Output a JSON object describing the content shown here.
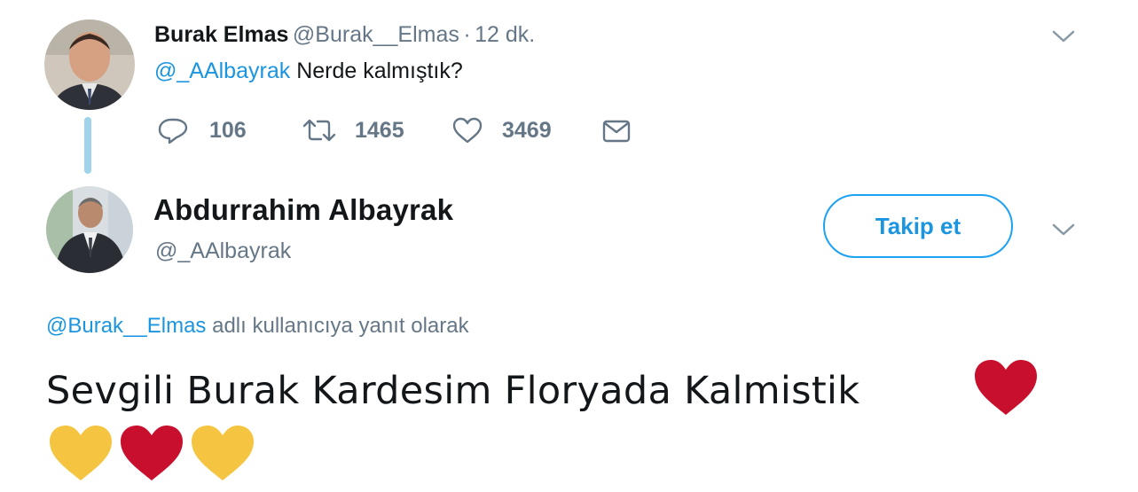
{
  "reply_tweet": {
    "author_name": "Burak Elmas",
    "author_handle": "@Burak__Elmas",
    "separator": "·",
    "time": "12 dk.",
    "mention": "@_AAlbayrak",
    "text": "Nerde kalmıştık?",
    "actions": {
      "replies": "106",
      "retweets": "1465",
      "likes": "3469"
    },
    "icons": [
      "reply-icon",
      "retweet-icon",
      "like-icon",
      "direct-message-icon",
      "chevron-down-icon"
    ]
  },
  "main_tweet": {
    "author_name": "Abdurrahim Albayrak",
    "author_handle": "@_AAlbayrak",
    "follow_label": "Takip et",
    "reply_to_mention": "@Burak__Elmas",
    "reply_to_suffix": "adlı kullanıcıya yanıt olarak",
    "text": "Sevgili Burak Kardesim Floryada Kalmistik"
  },
  "emoji": {
    "red_heart_color": "#c8102e",
    "yellow_heart_color": "#f5c542",
    "sequence": [
      "red-heart",
      "yellow-heart",
      "red-heart",
      "yellow-heart"
    ]
  },
  "colors": {
    "accent": "#1da1f2",
    "link": "#1b95e0",
    "muted": "#657786",
    "thread_line": "#9ed3ea"
  }
}
